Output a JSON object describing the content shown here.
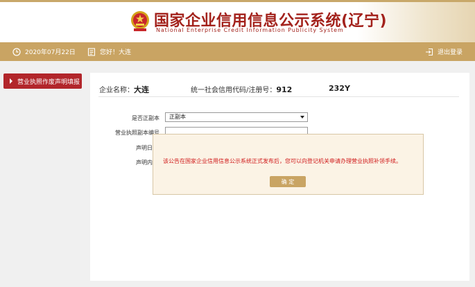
{
  "header": {
    "title_cn": "国家企业信用信息公示系统(辽宁)",
    "title_en": "National Enterprise Credit Information Publicity System"
  },
  "topbar": {
    "date": "2020年07月22日",
    "greeting": "您好！大连",
    "logout": "退出登录"
  },
  "sidebar": {
    "items": [
      {
        "label": "营业执照作废声明填报",
        "active": true
      }
    ]
  },
  "company": {
    "name_label": "企业名称：",
    "name_value": "大连",
    "code_label": "统一社会信用代码/注册号：",
    "code_prefix": "912",
    "code_suffix": "232Y"
  },
  "form": {
    "copy_type_label": "是否正副本",
    "copy_type_value": "正副本",
    "copy_number_label": "营业执照副本编号",
    "date_label": "声明日",
    "content_label": "声明内"
  },
  "dialog": {
    "message": "该公告在国家企业信用信息公示系统正式发布后，您可以向登记机关申请办理营业执照补领手续。",
    "ok_label": "确 定"
  },
  "colors": {
    "brand_red": "#a3221c",
    "gold": "#c9a463",
    "sidebar_red": "#b2262b",
    "alert_red": "#d01a1a"
  },
  "icons": {
    "emblem": "national-emblem-icon",
    "date": "clock-icon",
    "user": "user-card-icon",
    "logout": "logout-icon"
  }
}
